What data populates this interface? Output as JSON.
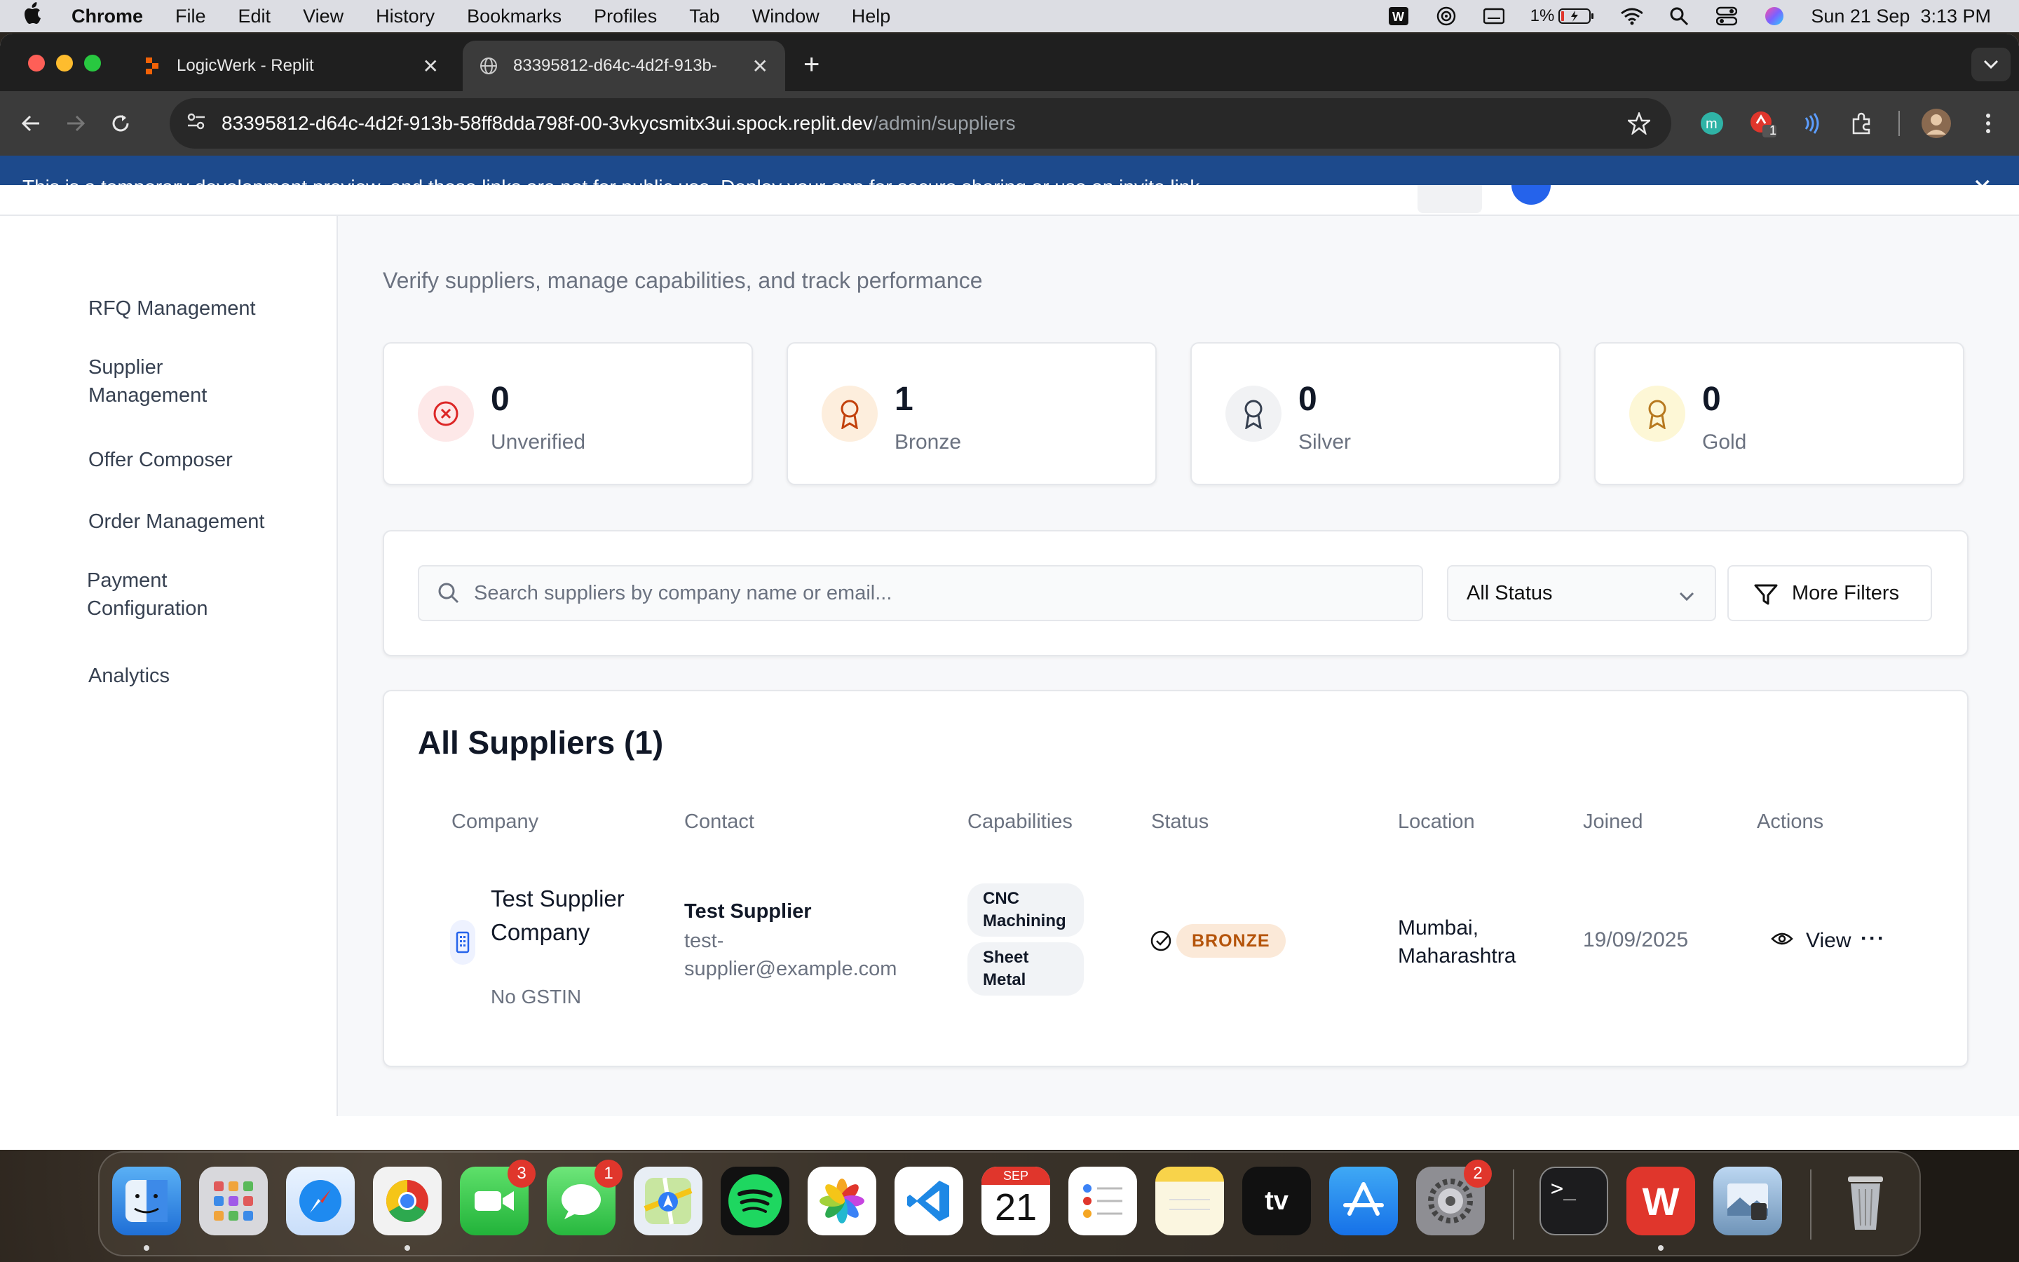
{
  "menubar": {
    "app": "Chrome",
    "items": [
      "File",
      "Edit",
      "View",
      "History",
      "Bookmarks",
      "Profiles",
      "Tab",
      "Window",
      "Help"
    ],
    "battery": "1%",
    "datetime": "Sun 21 Sep  3:13 PM"
  },
  "browser": {
    "tabs": [
      {
        "title": "LogicWerk - Replit"
      },
      {
        "title": "83395812-d64c-4d2f-913b-"
      }
    ],
    "url_host": "83395812-d64c-4d2f-913b-58ff8dda798f-00-3vkycsmitx3ui.spock.replit.dev",
    "url_path": "/admin/suppliers",
    "extension_badge": "1"
  },
  "banner": {
    "text_before": "This is a temporary development preview, and these links are not for public use. ",
    "link": "Deploy your app",
    "text_after": " for secure sharing or use an invite link."
  },
  "sidebar": {
    "items": [
      {
        "label": "RFQ Management"
      },
      {
        "label": "Supplier Management"
      },
      {
        "label": "Offer Composer"
      },
      {
        "label": "Order Management"
      },
      {
        "label": "Payment Configuration"
      },
      {
        "label": "Analytics"
      }
    ]
  },
  "page": {
    "subtitle": "Verify suppliers, manage capabilities, and track performance"
  },
  "stats": [
    {
      "value": "0",
      "label": "Unverified",
      "color": "#dc2626",
      "bg": "#fde8e8",
      "icon": "x-circle-icon"
    },
    {
      "value": "1",
      "label": "Bronze",
      "color": "#c2410c",
      "bg": "#fdeedd",
      "icon": "award-icon"
    },
    {
      "value": "0",
      "label": "Silver",
      "color": "#374151",
      "bg": "#f1f2f4",
      "icon": "award-icon"
    },
    {
      "value": "0",
      "label": "Gold",
      "color": "#b7791f",
      "bg": "#fdf7d6",
      "icon": "award-icon"
    }
  ],
  "filters": {
    "search_placeholder": "Search suppliers by company name or email...",
    "status_selected": "All Status",
    "more_filters": "More Filters"
  },
  "table": {
    "title": "All Suppliers (1)",
    "headers": [
      "Company",
      "Contact",
      "Capabilities",
      "Status",
      "Location",
      "Joined",
      "Actions"
    ],
    "rows": [
      {
        "company": "Test Supplier Company",
        "gstin": "No GSTIN",
        "contact_name": "Test Supplier",
        "contact_email": "test-supplier@example.com",
        "capabilities": [
          "CNC Machining",
          "Sheet Metal"
        ],
        "status": "BRONZE",
        "location": "Mumbai, Maharashtra",
        "joined": "19/09/2025",
        "view": "View",
        "more": "···"
      }
    ]
  },
  "dock": {
    "calendar_month": "SEP",
    "calendar_day": "21",
    "badges": {
      "facetime": "3",
      "messages": "1",
      "settings": "2"
    }
  }
}
